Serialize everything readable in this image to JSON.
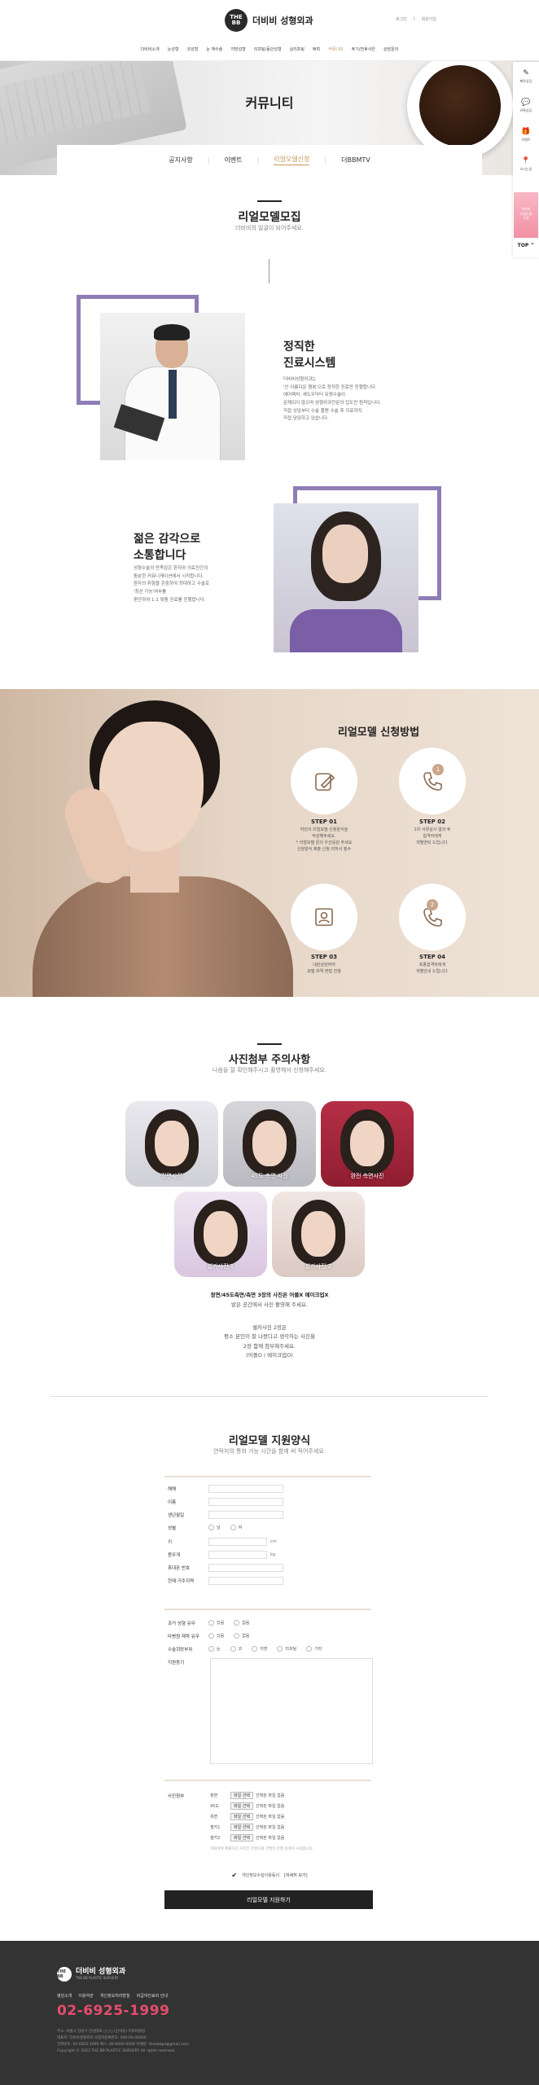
{
  "header": {
    "logo_mark": "THE BB",
    "logo_text": "더비비 성형외과",
    "util": [
      "로그인",
      "회원가입"
    ],
    "nav": [
      "더비비소개",
      "눈성형",
      "코성형",
      "눈 재수술",
      "지방성형",
      "리프팅/동안성형",
      "실리프팅",
      "쁘띠",
      "커뮤니티",
      "후기/전후사진",
      "상담문의"
    ],
    "nav_active_index": 8
  },
  "quick": {
    "items": [
      {
        "icon": "✎",
        "label": "빠른상담"
      },
      {
        "icon": "💬",
        "label": "카톡상담"
      },
      {
        "icon": "🎁",
        "label": "이벤트"
      },
      {
        "icon": "📍",
        "label": "오시는길"
      }
    ],
    "banner": "더비비\n리얼모델\n모집",
    "top": "TOP ^"
  },
  "hero": {
    "title": "커뮤니티",
    "tabs": [
      "공지사항",
      "이벤트",
      "리얼모델신청",
      "더BBMTV"
    ],
    "active_tab": 2
  },
  "section1": {
    "title": "리얼모델모집",
    "subtitle": "더비비의 얼굴이 되어주세요."
  },
  "block1": {
    "title": "정직한\n진료시스템",
    "text": "더비비성형외과는\n'안 아름다운 행복'으로 정직한 진료만 진행합니다.\n에어렉처, 새도우닥터 유령수술이\n문제되지 않으며 성형외과전문의 집도만 원칙입니다.\n직접 상담부터 수술 플랜 수술 후 지료까지\n직접 담당하고 있습니다."
  },
  "block2": {
    "title": "젊은 감각으로\n소통합니다",
    "text": "성형수술의 만족감은 환자와 의료진간의\n충분한 커뮤니케이션에서 시작합니다.\n환자의 취향을 존중하여 최대하고 수술로\n'최선 가능'여부를\n판단하여 1:1 맞춤 진료를 진행합니다."
  },
  "apply": {
    "title": "리얼모델 신청방법",
    "steps": [
      {
        "num": "1",
        "label": "STEP 01",
        "text": "하단의 리얼모델 신청양식을\n작성해주세요.\n* 리얼모델 문의 우선응원 주세요\n신청양식 제출 신청 리허서 필수"
      },
      {
        "num": "1",
        "label": "STEP 02",
        "text": "1차 서류심사 결과 후\n합격자에게\n개별연락 드립니다."
      },
      {
        "num": "",
        "label": "STEP 03",
        "text": "내원상담하여\n모델 자격 면접 진행"
      },
      {
        "num": "2",
        "label": "STEP 04",
        "text": "최종합격자에게\n개별안내 드립니다."
      }
    ]
  },
  "photos": {
    "title": "사진첨부 주의사항",
    "subtitle": "나음을 잘 확인해주시고 촬영해서 신청해주세요.",
    "thumbs": [
      "정면사진",
      "45도 측면 사진",
      "완전 측면사진",
      "셀카사진 1",
      "셀카사진 2"
    ],
    "note_bold": "정면/45도측면/측면 3장의 사진은 어플X 메이크업X",
    "note_line2": "밝은 공간에서 사진 촬영해 주세요.",
    "note_extra": "셀카사진 2장은\n평소 본인이 잘 나왔다고 생각하는 사진을\n2장 함께 첨부해주세요.\n(어플O / 메이크업O)"
  },
  "form": {
    "title": "리얼모델 지원양식",
    "subtitle": "연락처의 통화 가능 시간을 함께 써 적어주세요.",
    "basic_fields": [
      "해해",
      "이름",
      "생년월일",
      "성별",
      "키",
      "몸무게",
      "휴대폰 번호",
      "현재 거주지역"
    ],
    "gender_options": [
      "남",
      "여"
    ],
    "units": {
      "height": "cm",
      "weight": "kg"
    },
    "survey_fields": [
      "과거 성형 유무",
      "타병원 재학 유무",
      "수술희망부위",
      "지원동기"
    ],
    "yesno": [
      "있음",
      "없음"
    ],
    "surgery_parts": [
      "눈",
      "코",
      "지방",
      "리프팅",
      "기타"
    ],
    "attach_label": "사진첨부",
    "attach_rows": [
      "정면",
      "45도",
      "측면",
      "셀카1",
      "셀카2"
    ],
    "file_button": "파일 선택",
    "file_status": "선택된 파일 없음",
    "attach_note": "지원서에 제출하신 사진은 리얼모델 선발이 진행 중에서 사용됩니다.",
    "agree_text": "개인정보수집이용동의",
    "agree_link": "[자세히 보기]",
    "submit": "리얼모델 지원하기"
  },
  "footer": {
    "logo_mark": "THE BB",
    "name": "더비비 성형외과",
    "eng": "THE BB PLASTIC SURGERY",
    "links": [
      "병원소개",
      "이용약관",
      "개인정보처리방침",
      "비급여진료비 안내"
    ],
    "phone": "02-6925-1999",
    "info": "주소: 서울시 강남구 강남대로 ○○○ (신사동) 더비비빌딩\n대표자: 더비비성형외과 사업자등록번호: 000-00-00000\n전화번호: 02-6925-1999 팩스: 00-0000-0000 이메일: theabbps@gmail.com\nCopyright © 2023 THE BB PLASTIC SURGERY All rights reserved."
  },
  "colors": {
    "accent": "#c89a5a",
    "frame_purple": "#8f7db6",
    "footer_bg": "#333333",
    "phone": "#e64c6c"
  }
}
